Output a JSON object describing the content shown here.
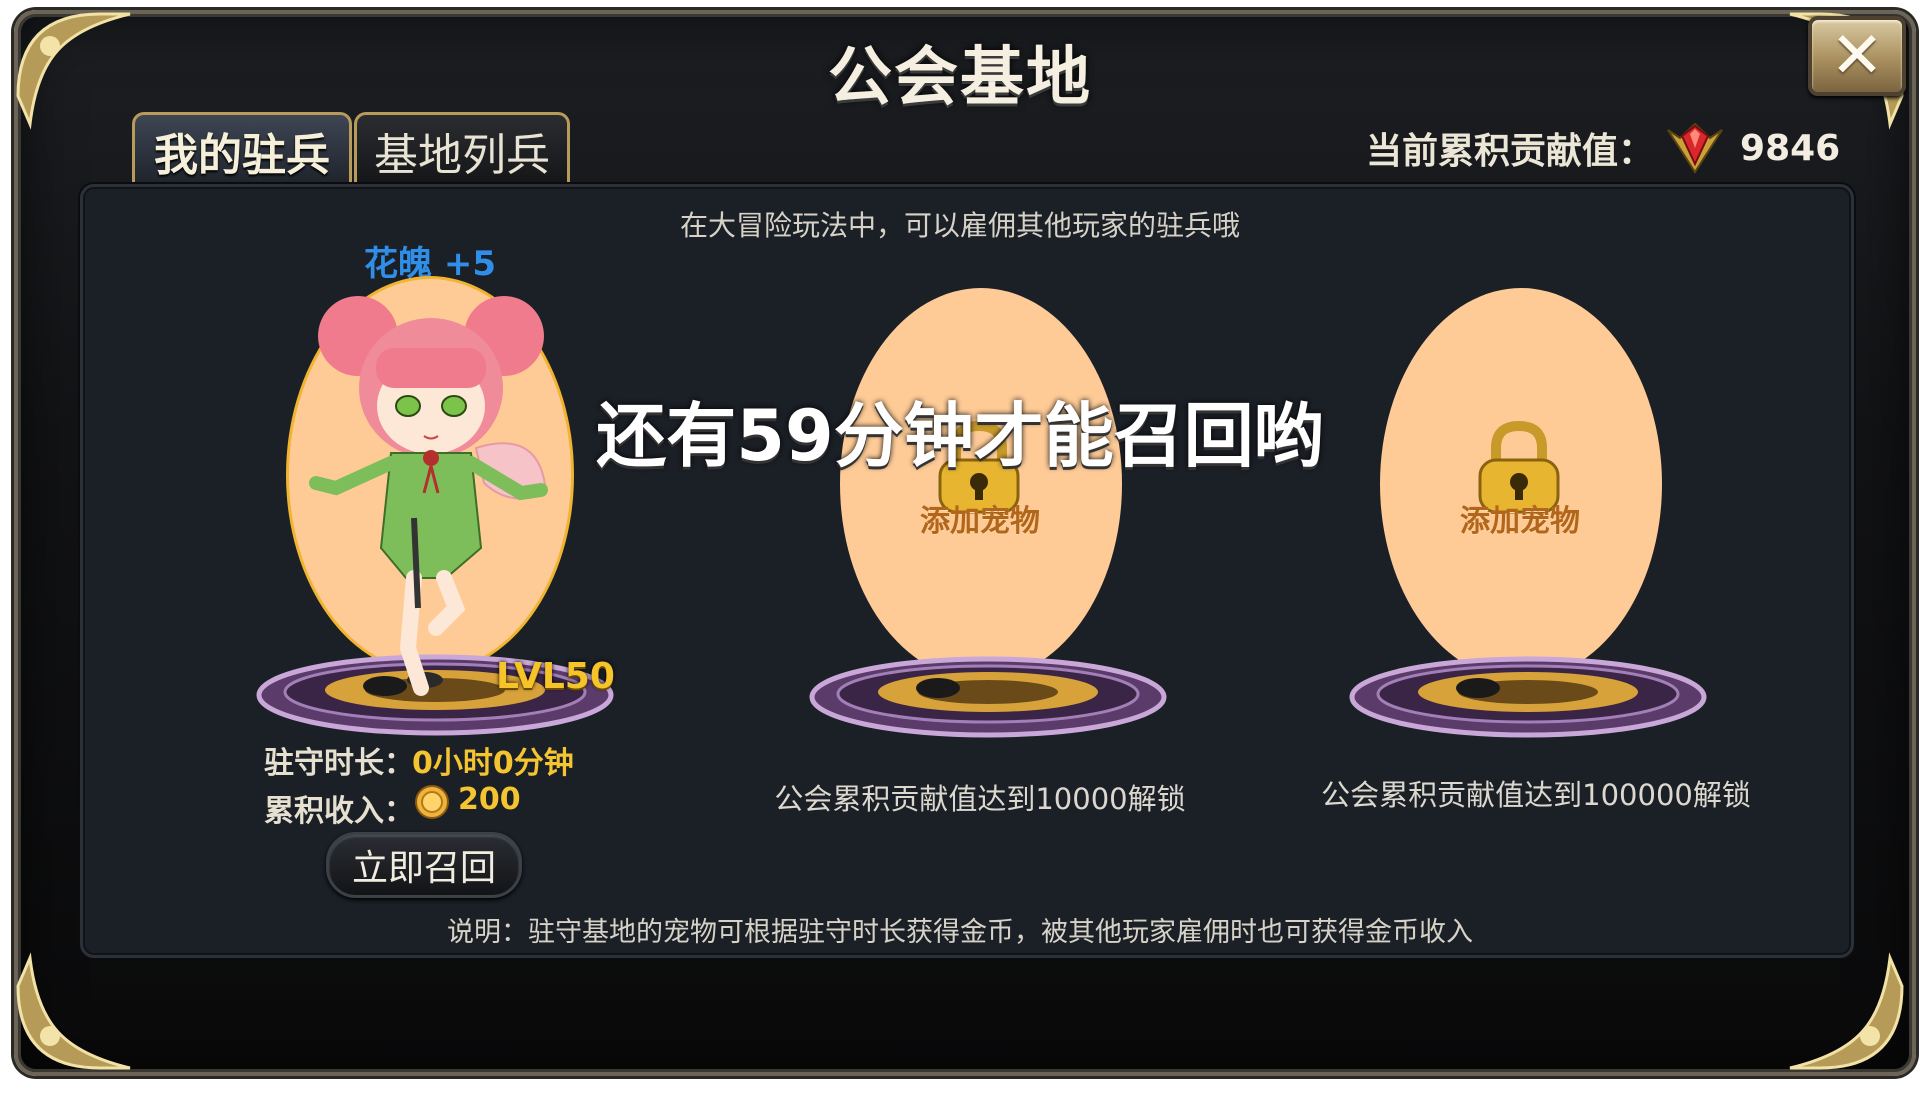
{
  "window": {
    "title": "公会基地",
    "close_icon": "close-icon"
  },
  "tabs": [
    {
      "label": "我的驻兵",
      "active": true
    },
    {
      "label": "基地列兵",
      "active": false
    }
  ],
  "contribution": {
    "label": "当前累积贡献值：",
    "value": "9846",
    "icon": "red-gem-icon"
  },
  "hint": "在大冒险玩法中，可以雇佣其他玩家的驻兵哦",
  "slots": [
    {
      "pet_name": "花魄 +5",
      "level": "LVL50",
      "duration_label": "驻守时长：",
      "duration_value": "0小时0分钟",
      "income_label": "累积收入：",
      "income_value": "200",
      "income_icon": "gold-coin-icon",
      "action": "立即召回"
    },
    {
      "add_label": "添加宠物",
      "unlock_text": "公会累积贡献值达到10000解锁",
      "icon": "lock-icon"
    },
    {
      "add_label": "添加宠物",
      "unlock_text": "公会累积贡献值达到100000解锁",
      "icon": "lock-icon"
    }
  ],
  "overlay_message": "还有59分钟才能召回哟",
  "note": "说明：驻守基地的宠物可根据驻守时长获得金币，被其他玩家雇佣时也可获得金币收入",
  "colors": {
    "egg": "#fecb97",
    "accent_gold": "#f5c531",
    "pet_name_blue": "#2f8ee8",
    "panel": "#1b1f26"
  }
}
